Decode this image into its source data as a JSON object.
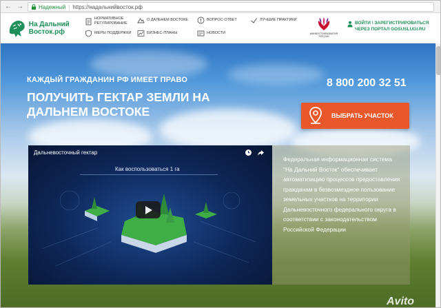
{
  "browser": {
    "back_glyph": "←",
    "forward_glyph": "→",
    "reload_glyph": "C",
    "secure_label": "Надежный",
    "url": "https://надальнийвосток.рф"
  },
  "header": {
    "logo_text": "На Дальний Восток.рф",
    "menu": [
      {
        "label": "Нормативное регулирование",
        "icon": "document-icon"
      },
      {
        "label": "Меры поддержки",
        "icon": "shield-icon"
      },
      {
        "label": "О Дальнем Востоке",
        "icon": "mountain-icon"
      },
      {
        "label": "Бизнес-планы",
        "icon": "chart-icon"
      },
      {
        "label": "Вопрос-ответ",
        "icon": "exclamation-icon"
      },
      {
        "label": "Новости",
        "icon": "news-icon"
      },
      {
        "label": "Лучшие практики",
        "icon": "star-icon"
      }
    ],
    "partner_text": "Минвостокразвития России",
    "login_text": "Войти \\ зарегистрироваться через портал gosuslugi.ru"
  },
  "hero": {
    "pre_title": "Каждый гражданин РФ имеет право",
    "title": "Получить гектар земли на Дальнем Востоке",
    "phone": "8 800 200 32 51",
    "cta_label": "Выбрать участок"
  },
  "video": {
    "title": "Дальневосточный гектар",
    "caption": "Как воспользоваться 1 га"
  },
  "description": "Федеральная информационная система \"На Дальний Восток\" обеспечивает автоматизацию процессов предоставления гражданам в безвозмездное пользование земельных участков на территории Дальневосточного федерального округа в соответствии с законодательством Российской Федерации",
  "watermark": "Avito",
  "colors": {
    "brand_green": "#1d8f5a",
    "cta_orange": "#e8582b"
  }
}
